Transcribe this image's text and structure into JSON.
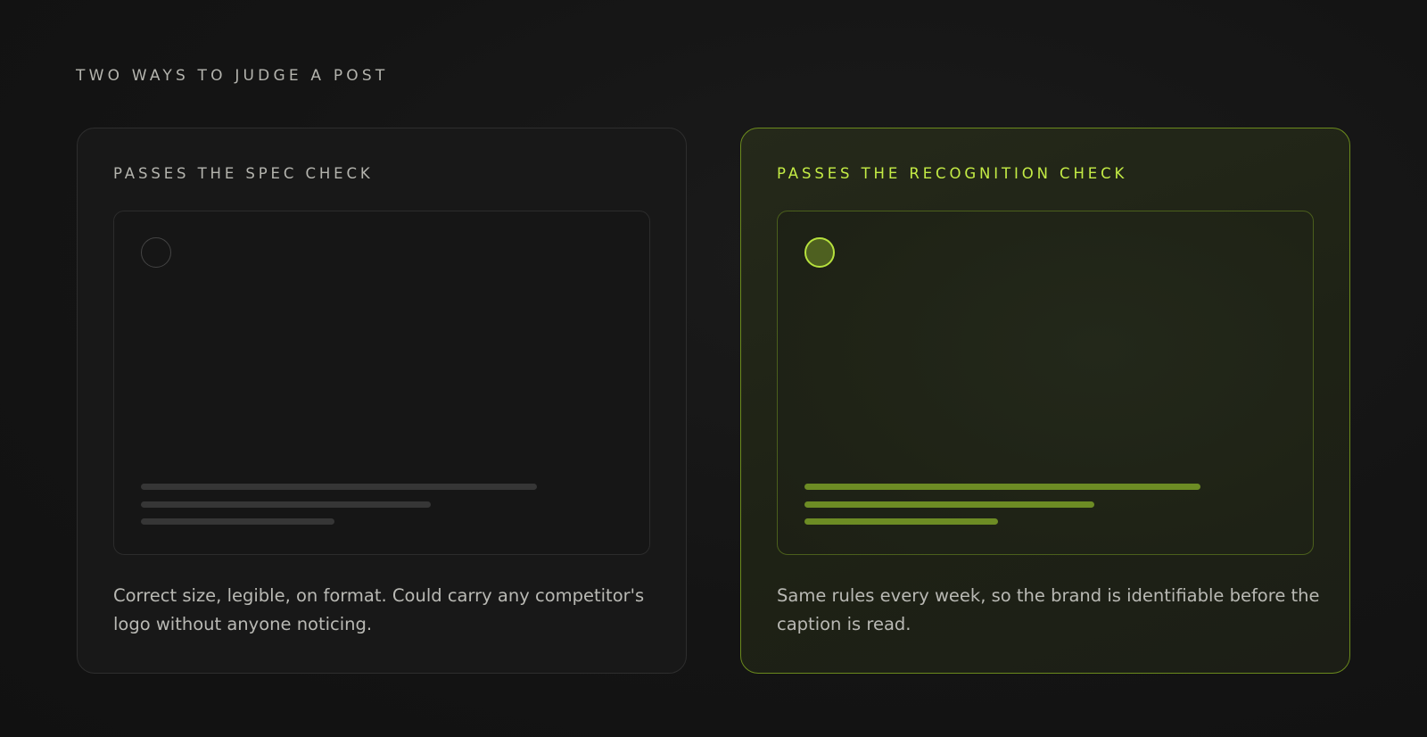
{
  "eyebrow": "TWO WAYS TO JUDGE A POST",
  "cards": [
    {
      "title": "PASSES THE SPEC CHECK",
      "description": "Correct size, legible, on format. Could carry any competitor's logo without anyone noticing."
    },
    {
      "title": "PASSES THE RECOGNITION CHECK",
      "description": "Same rules every week, so the brand is identifiable before the caption is read."
    }
  ],
  "colors": {
    "background": "#141414",
    "neutral_text": "#b4b4ae",
    "accent": "#c4ec45",
    "accent_muted": "#6d8c24",
    "neutral_bar": "#363636"
  },
  "icons": {
    "avatar": "avatar-circle-placeholder"
  }
}
